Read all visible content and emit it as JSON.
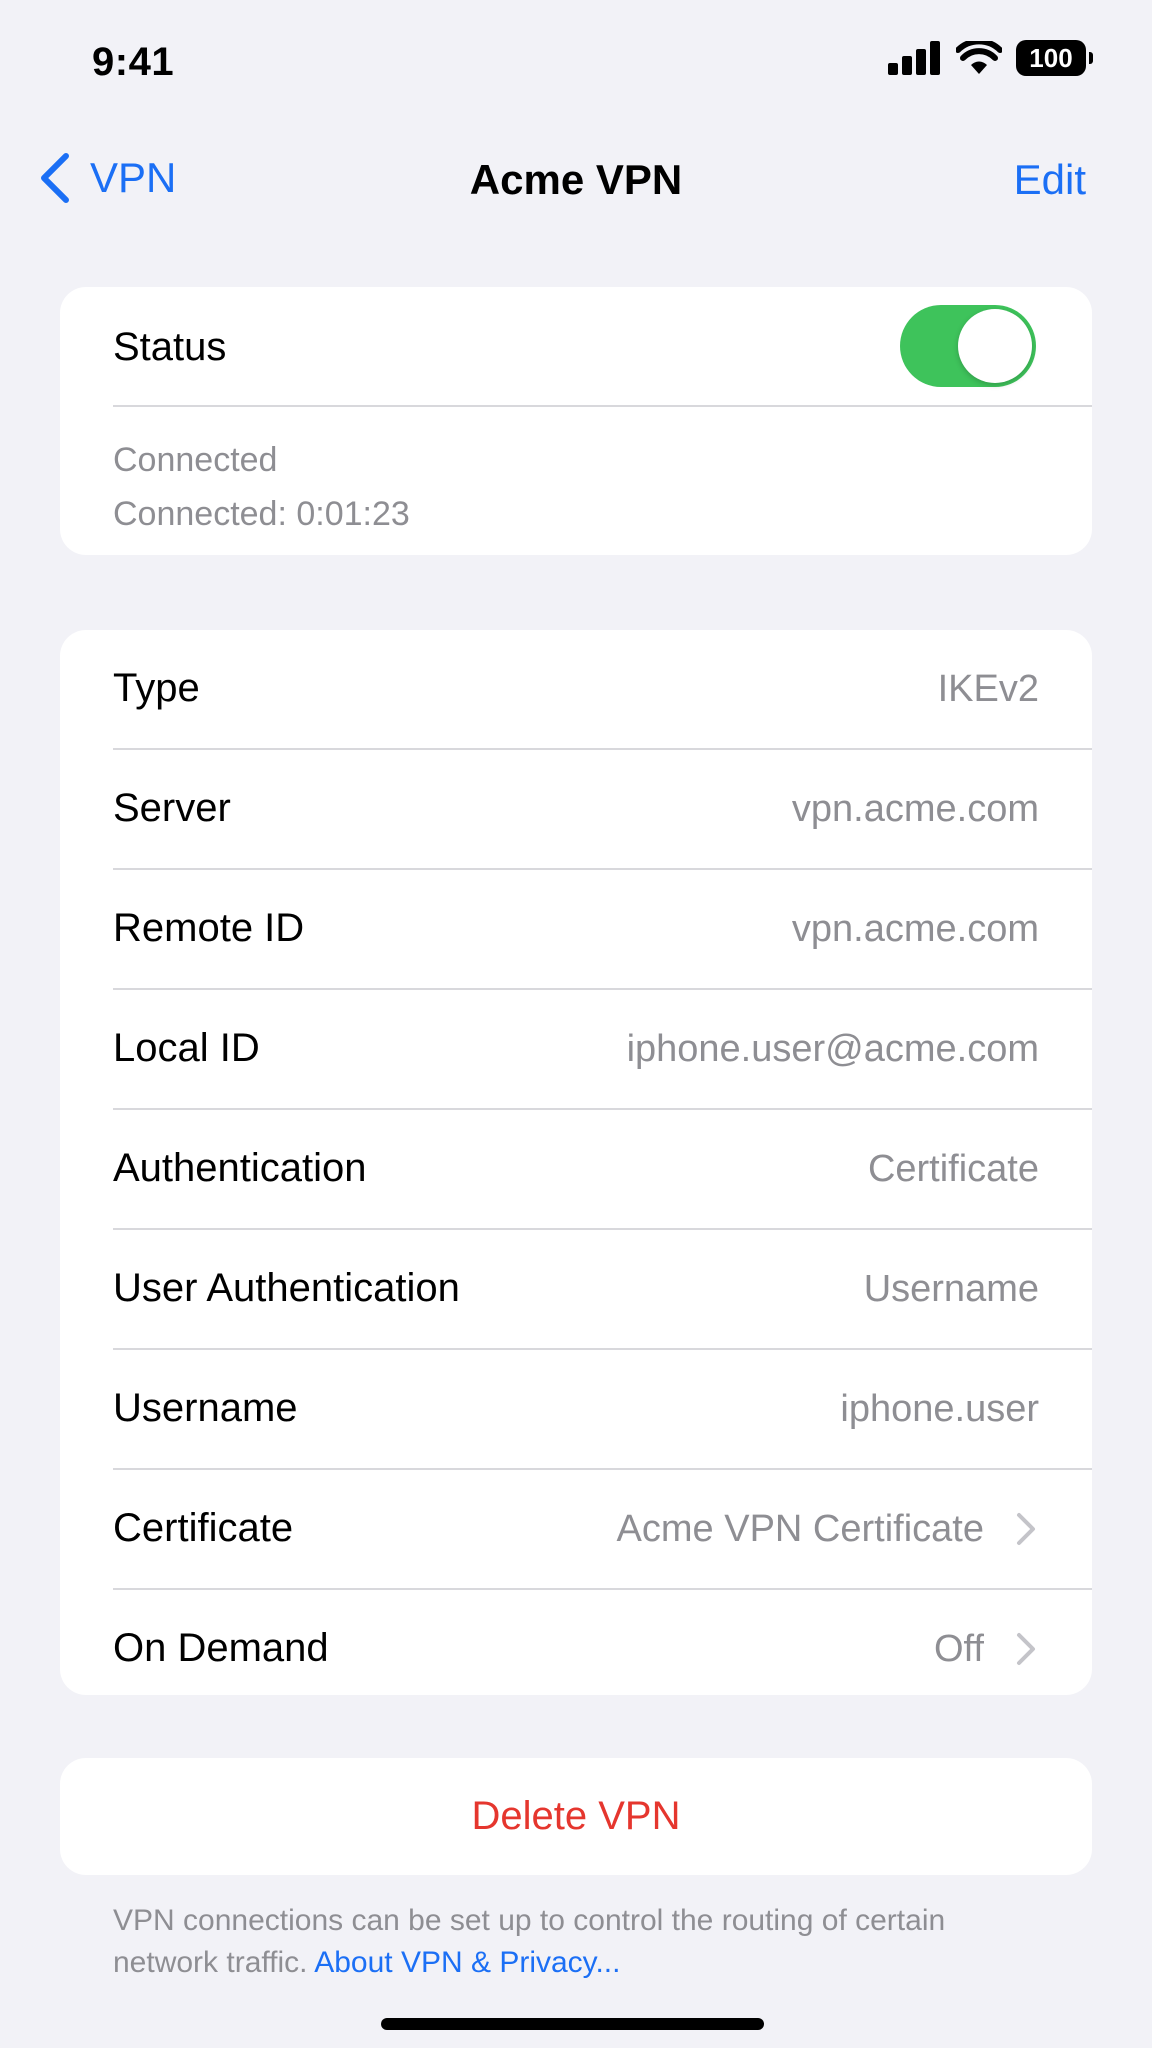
{
  "status_bar": {
    "time": "9:41",
    "battery": "100"
  },
  "nav": {
    "back_label": "VPN",
    "title": "Acme VPN",
    "edit_label": "Edit"
  },
  "status": {
    "label": "Status",
    "toggle_on": true,
    "state": "Connected",
    "duration": "Connected: 0:01:23"
  },
  "details": [
    {
      "label": "Type",
      "value": "IKEv2"
    },
    {
      "label": "Server",
      "value": "vpn.acme.com"
    },
    {
      "label": "Remote ID",
      "value": "vpn.acme.com"
    },
    {
      "label": "Local ID",
      "value": "iphone.user@acme.com"
    },
    {
      "label": "Authentication",
      "value": "Certificate"
    },
    {
      "label": "User Authentication",
      "value": "Username"
    },
    {
      "label": "Username",
      "value": "iphone.user"
    },
    {
      "label": "Certificate",
      "value": "Acme VPN Certificate"
    },
    {
      "label": "On Demand",
      "value": "Off"
    }
  ],
  "delete_label": "Delete VPN",
  "footer": {
    "text": "VPN connections can be set up to control the routing of certain network traffic.",
    "link": "About VPN & Privacy..."
  },
  "colors": {
    "accent": "#1b6ff5",
    "toggle_on": "#3ec35b",
    "destructive": "#e5362e",
    "background": "#f2f2f7"
  },
  "icons": {
    "back": "chevron-left-icon",
    "signal": "cellular-signal-icon",
    "wifi": "wifi-icon",
    "battery": "battery-icon",
    "disclosure": "chevron-right-icon"
  }
}
